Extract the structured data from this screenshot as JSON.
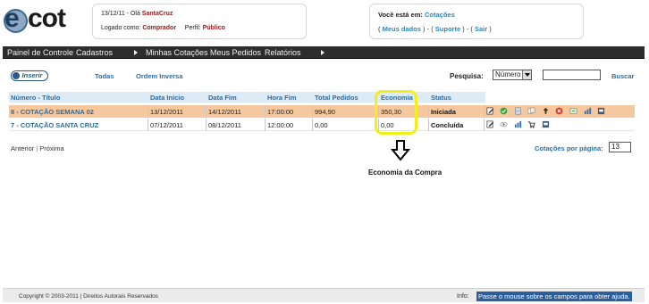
{
  "logo": {
    "e": "e",
    "cot": "cot"
  },
  "user_box": {
    "date_greeting": "13/12/11 - Olá",
    "user_name": "SantaCruz",
    "logged_as_label": "Logado como:",
    "logged_as_value": "Comprador",
    "profile_label": "Perfil:",
    "profile_value": "Público"
  },
  "location_box": {
    "label": "Você está em:",
    "current": "Cotações",
    "open_paren_1": "(",
    "link_my_data": "Meus dados",
    "sep_1": ") - (",
    "link_support": "Suporte",
    "sep_2": ") - (",
    "link_exit": "Sair",
    "close_paren": ")"
  },
  "menu": {
    "items": [
      "Painel de Controle",
      "Cadastros",
      "Minhas Cotações",
      "Meus Pedidos",
      "Relatórios"
    ]
  },
  "toolbar": {
    "insert_label": "Inserir",
    "all_label": "Todas",
    "reverse_label": "Ordem Inversa",
    "search_label": "Pesquisa:",
    "search_select_value": "Número",
    "search_button": "Buscar"
  },
  "table": {
    "headers": [
      "Número - Título",
      "Data Início",
      "Data Fim",
      "Hora Fim",
      "Total Pedidos",
      "Economia",
      "Status"
    ],
    "rows": [
      {
        "title": "8 - COTAÇÃO SEMANA 02",
        "start": "13/12/2011",
        "end": "14/12/2011",
        "hour": "17:00:00",
        "total": "994,90",
        "economy": "350,30",
        "status": "Iniciada",
        "actions": [
          "edit-icon",
          "check-icon",
          "document-icon",
          "copy-icon",
          "cart-icon",
          "cancel-icon",
          "refresh-icon",
          "chart-icon",
          "printer-icon"
        ]
      },
      {
        "title": "7 - COTAÇÃO SANTA CRUZ",
        "start": "07/12/2011",
        "end": "08/12/2011",
        "hour": "12:00:00",
        "total": "0,00",
        "economy": "0,00",
        "status": "Concluída",
        "actions": [
          "edit-icon",
          "view-icon",
          "chart-icon",
          "cart-icon",
          "printer-icon"
        ]
      }
    ]
  },
  "annotation": {
    "caption": "Economia da Compra"
  },
  "pager": {
    "prev": "Anterior",
    "next": "Próxima",
    "per_page_label": "Cotações por página:",
    "per_page_value": "13"
  },
  "footer": {
    "copyright": "Copyright © 2003-2011 | Direitos Autorais Reservados",
    "info_label": "Info:",
    "info_text": "Passe o mouse sobre os campos para obter ajuda."
  },
  "colors": {
    "menu_bg": "#2d2d2d",
    "row_highlight": "#f5c8a0",
    "link": "#2e6c9a",
    "highlight_ring": "#f2f019",
    "info_bg": "#2a5f9a"
  }
}
